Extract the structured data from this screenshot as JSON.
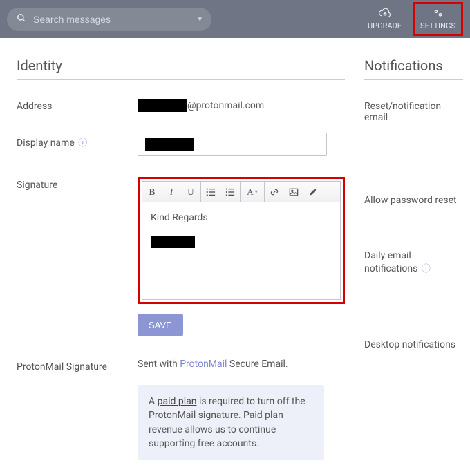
{
  "topbar": {
    "search_placeholder": "Search messages",
    "upgrade_label": "UPGRADE",
    "settings_label": "SETTINGS"
  },
  "identity": {
    "heading": "Identity",
    "address_label": "Address",
    "address_domain": "@protonmail.com",
    "display_name_label": "Display name",
    "signature_label": "Signature",
    "signature_body_line1": "Kind Regards",
    "save_label": "SAVE",
    "pm_sig_label": "ProtonMail Signature",
    "pm_sig_prefix": "Sent with ",
    "pm_sig_link": "ProtonMail",
    "pm_sig_suffix": " Secure Email.",
    "notice_prefix": "A ",
    "notice_link": "paid plan",
    "notice_suffix": " is required to turn off the ProtonMail signature. Paid plan revenue allows us to continue supporting free accounts."
  },
  "notifications": {
    "heading": "Notifications",
    "reset_label": "Reset/notification email",
    "allow_reset_label": "Allow password reset",
    "daily_label": "Daily email notifications",
    "desktop_label": "Desktop notifications"
  }
}
